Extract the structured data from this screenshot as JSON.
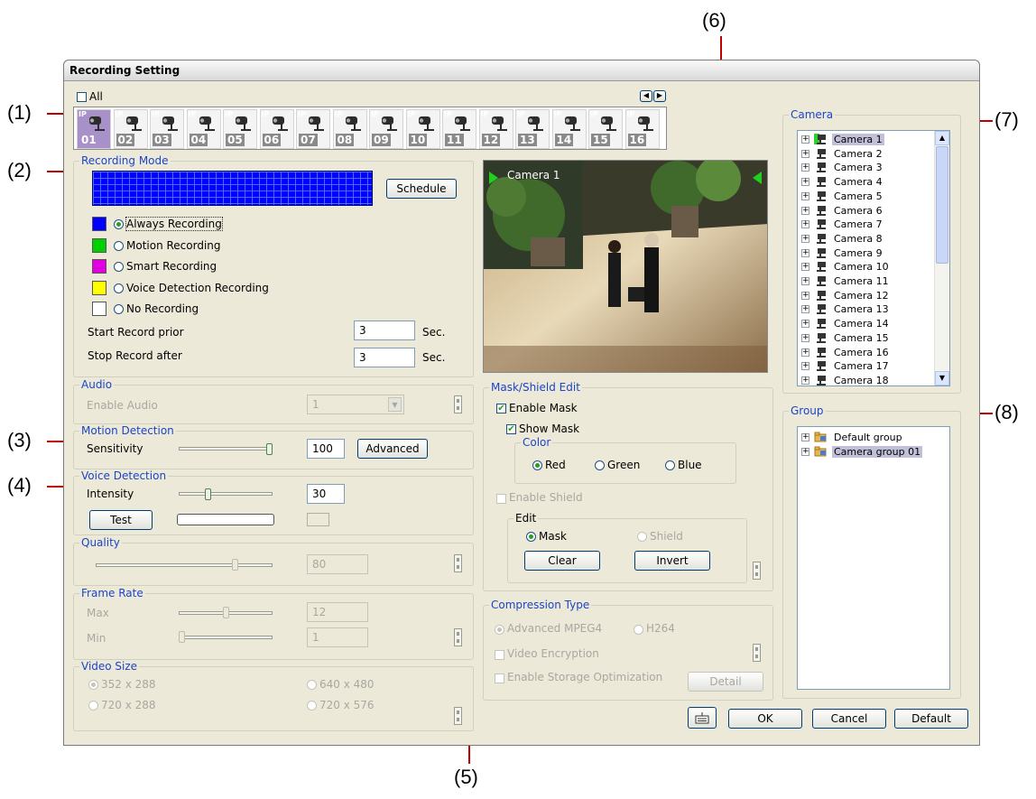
{
  "window": {
    "title": "Recording Setting"
  },
  "callouts": [
    "(1)",
    "(2)",
    "(3)",
    "(4)",
    "(5)",
    "(6)",
    "(7)",
    "(8)"
  ],
  "top": {
    "all_label": "All",
    "cameras": [
      "01",
      "02",
      "03",
      "04",
      "05",
      "06",
      "07",
      "08",
      "09",
      "10",
      "11",
      "12",
      "13",
      "14",
      "15",
      "16"
    ],
    "ip_tag": "IP"
  },
  "recording_mode": {
    "title": "Recording Mode",
    "schedule_button": "Schedule",
    "modes": [
      {
        "label": "Always Recording",
        "color": "#0000ff",
        "selected": true
      },
      {
        "label": "Motion Recording",
        "color": "#00d000",
        "selected": false
      },
      {
        "label": "Smart Recording",
        "color": "#e000e0",
        "selected": false
      },
      {
        "label": "Voice Detection Recording",
        "color": "#ffff00",
        "selected": false
      },
      {
        "label": "No Recording",
        "color": "#ffffff",
        "selected": false
      }
    ],
    "start_prior_label": "Start Record prior",
    "start_prior_value": "3",
    "start_prior_unit": "Sec.",
    "stop_after_label": "Stop Record after",
    "stop_after_value": "3",
    "stop_after_unit": "Sec."
  },
  "audio": {
    "title": "Audio",
    "enable_label": "Enable Audio",
    "value": "1"
  },
  "motion": {
    "title": "Motion Detection",
    "sensitivity_label": "Sensitivity",
    "value": "100",
    "level": 1.0,
    "advanced_button": "Advanced"
  },
  "voice": {
    "title": "Voice Detection",
    "intensity_label": "Intensity",
    "value": "30",
    "level": 0.3,
    "test_button": "Test"
  },
  "quality": {
    "title": "Quality",
    "value": "80",
    "level": 0.8
  },
  "frame_rate": {
    "title": "Frame Rate",
    "max_label": "Max",
    "max_value": "12",
    "max_level": 0.5,
    "min_label": "Min",
    "min_value": "1",
    "min_level": 0.0
  },
  "video_size": {
    "title": "Video Size",
    "options": [
      "352 x 288",
      "640 x 480",
      "720 x 288",
      "720 x 576"
    ]
  },
  "preview": {
    "camera_label": "Camera 1"
  },
  "mask": {
    "title": "Mask/Shield Edit",
    "enable_mask": "Enable Mask",
    "show_mask": "Show Mask",
    "color_title": "Color",
    "colors": [
      "Red",
      "Green",
      "Blue"
    ],
    "enable_shield": "Enable Shield",
    "edit_title": "Edit",
    "edit_mask": "Mask",
    "edit_shield": "Shield",
    "clear_button": "Clear",
    "invert_button": "Invert"
  },
  "compression": {
    "title": "Compression Type",
    "mpeg4": "Advanced MPEG4",
    "h264": "H264",
    "encryption": "Video Encryption",
    "storage_opt": "Enable Storage Optimization",
    "detail_button": "Detail"
  },
  "camera_panel": {
    "title": "Camera",
    "items": [
      "Camera 1",
      "Camera 2",
      "Camera 3",
      "Camera 4",
      "Camera 5",
      "Camera 6",
      "Camera 7",
      "Camera 8",
      "Camera 9",
      "Camera 10",
      "Camera 11",
      "Camera 12",
      "Camera 13",
      "Camera 14",
      "Camera 15",
      "Camera 16",
      "Camera 17",
      "Camera 18"
    ]
  },
  "group_panel": {
    "title": "Group",
    "items": [
      "Default group",
      "Camera group 01"
    ]
  },
  "footer": {
    "ok": "OK",
    "cancel": "Cancel",
    "default": "Default"
  }
}
